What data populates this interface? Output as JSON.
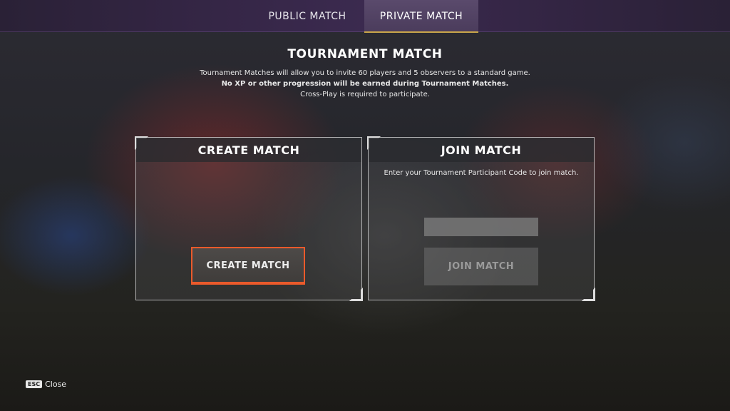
{
  "tabs": [
    {
      "label": "PUBLIC MATCH",
      "active": false
    },
    {
      "label": "PRIVATE MATCH",
      "active": true
    }
  ],
  "header": {
    "title": "TOURNAMENT MATCH",
    "lines": [
      "Tournament Matches will allow you to invite 60 players and 5 observers to a standard game.",
      "No XP or other progression will be earned during Tournament Matches.",
      "Cross-Play is required to participate."
    ]
  },
  "create_panel": {
    "title": "CREATE MATCH",
    "button_label": "CREATE MATCH"
  },
  "join_panel": {
    "title": "JOIN MATCH",
    "hint": "Enter your Tournament Participant Code to join match.",
    "code_value": "",
    "button_label": "JOIN MATCH"
  },
  "footer": {
    "key": "ESC",
    "label": "Close"
  },
  "colors": {
    "accent_orange": "#ea5a2b",
    "tab_gold": "#c9a64a",
    "topbar_purple": "#3b2a4f"
  }
}
